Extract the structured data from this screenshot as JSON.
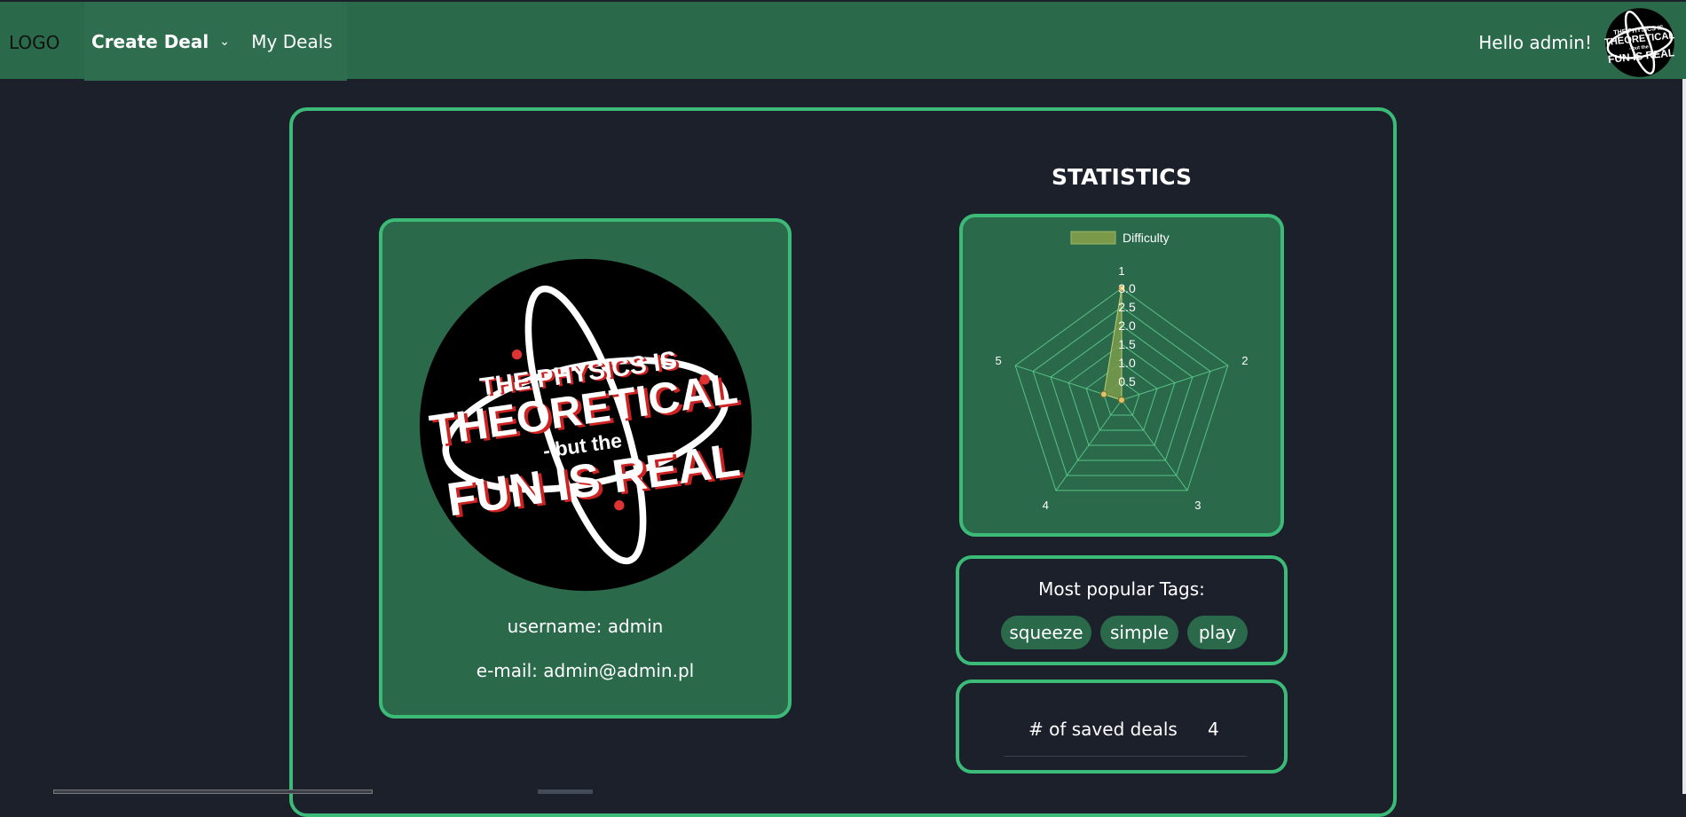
{
  "navbar": {
    "logo": "LOGO",
    "create_deal": "Create Deal",
    "my_deals": "My Deals",
    "greeting": "Hello admin!",
    "colors": {
      "bar": "#2a6a4b",
      "accent": "#3bbb77",
      "background": "#1b202b"
    }
  },
  "logo_art": {
    "line1": "THE PHYSICS IS",
    "line2": "THEORETICAL",
    "line3": "- but the -",
    "line4": "FUN IS REAL"
  },
  "profile": {
    "username": "username: admin",
    "email": "e-mail: admin@admin.pl"
  },
  "statistics": {
    "title": "STATISTICS",
    "tags_title": "Most popular Tags:",
    "tags": [
      "squeeze",
      "simple",
      "play"
    ],
    "saved_label": "# of saved deals",
    "saved_value": "4"
  },
  "chart_data": {
    "type": "radar",
    "legend": "Difficulty",
    "categories": [
      "1",
      "2",
      "3",
      "4",
      "5"
    ],
    "values": [
      3,
      0,
      0,
      0,
      0.5
    ],
    "rlim": [
      0,
      3
    ],
    "ticks": [
      "0.5",
      "1.0",
      "1.5",
      "2.0",
      "2.5",
      "3.0"
    ],
    "fill_color": "#7a9a4a",
    "grid_color": "#5fd08f"
  }
}
